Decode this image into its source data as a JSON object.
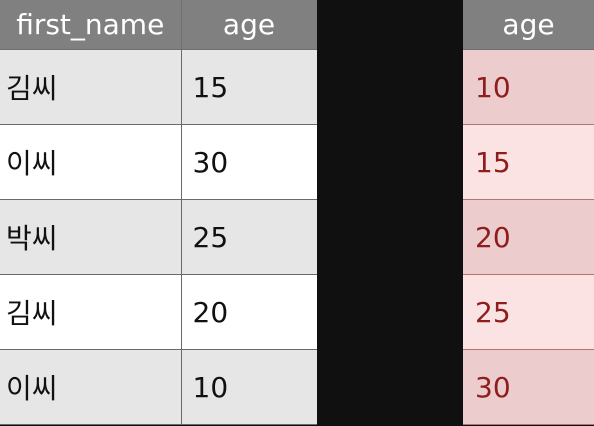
{
  "left_table": {
    "headers": [
      "first_name",
      "age"
    ],
    "rows": [
      {
        "first_name": "김씨",
        "age": "15"
      },
      {
        "first_name": "이씨",
        "age": "30"
      },
      {
        "first_name": "박씨",
        "age": "25"
      },
      {
        "first_name": "김씨",
        "age": "20"
      },
      {
        "first_name": "이씨",
        "age": "10"
      }
    ]
  },
  "right_table": {
    "headers": [
      "age"
    ],
    "rows": [
      {
        "age": "10"
      },
      {
        "age": "15"
      },
      {
        "age": "20"
      },
      {
        "age": "25"
      },
      {
        "age": "30"
      }
    ]
  },
  "colors": {
    "header_bg": "#808080",
    "row_odd_bg": "#e6e6e6",
    "row_even_bg": "#ffffff",
    "sorted_odd_bg": "#eccccc",
    "sorted_even_bg": "#fce3e3",
    "sorted_text": "#8e1d1d",
    "divider": "#101010"
  }
}
